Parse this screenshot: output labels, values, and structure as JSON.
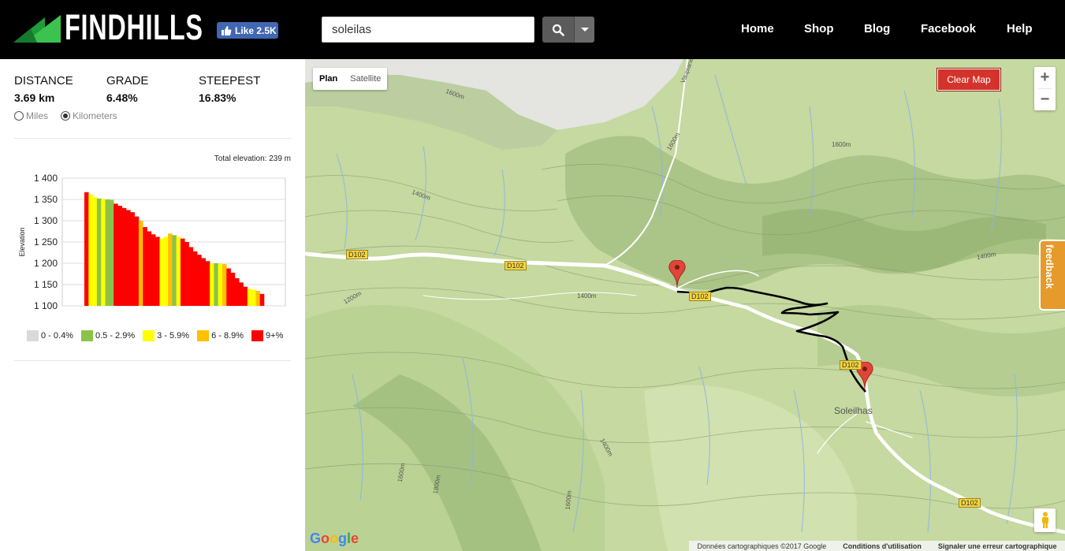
{
  "header": {
    "logo_text": "FINDHILLS",
    "like_label": "Like 2.5K",
    "search_value": "soleilas",
    "nav": [
      "Home",
      "Shop",
      "Blog",
      "Facebook",
      "Help"
    ]
  },
  "stats": {
    "distance_label": "DISTANCE",
    "distance_value": "3.69 km",
    "grade_label": "GRADE",
    "grade_value": "6.48%",
    "steepest_label": "STEEPEST",
    "steepest_value": "16.83%",
    "unit_miles": "Miles",
    "unit_km": "Kilometers",
    "selected_unit": "Kilometers"
  },
  "elevation": {
    "total_label": "Total elevation: 239 m"
  },
  "chart_data": {
    "type": "area",
    "title": "",
    "xlabel": "",
    "ylabel": "Elevation",
    "ylim": [
      1100,
      1400
    ],
    "yticks": [
      "1 400",
      "1 350",
      "1 300",
      "1 250",
      "1 200",
      "1 150",
      "1 100"
    ],
    "grid": true,
    "series": [
      {
        "values": [
          1367,
          1362,
          1355,
          1352,
          1351,
          1350,
          1349,
          1340,
          1335,
          1330,
          1325,
          1320,
          1310,
          1300,
          1285,
          1275,
          1268,
          1262,
          1258,
          1262,
          1270,
          1266,
          1262,
          1258,
          1250,
          1238,
          1228,
          1220,
          1212,
          1205,
          1200,
          1200,
          1199,
          1198,
          1188,
          1178,
          1165,
          1155,
          1145,
          1140,
          1138,
          1135,
          1128
        ],
        "grade_classes": [
          "9+",
          "3-5.9",
          "3-5.9",
          "0.5-2.9",
          "3-5.9",
          "0.5-2.9",
          "0.5-2.9",
          "9+",
          "9+",
          "9+",
          "9+",
          "9+",
          "9+",
          "6-8.9",
          "9+",
          "9+",
          "9+",
          "9+",
          "3-5.9",
          "3-5.9",
          "6-8.9",
          "0.5-2.9",
          "3-5.9",
          "9+",
          "9+",
          "9+",
          "9+",
          "9+",
          "9+",
          "9+",
          "3-5.9",
          "0.5-2.9",
          "3-5.9",
          "6-8.9",
          "9+",
          "9+",
          "9+",
          "9+",
          "9+",
          "3-5.9",
          "3-5.9",
          "6-8.9",
          "9+"
        ]
      }
    ],
    "legend": [
      {
        "label": "0 - 0.4%",
        "color": "#d9d9d9"
      },
      {
        "label": "0.5 - 2.9%",
        "color": "#8bc34a"
      },
      {
        "label": "3 - 5.9%",
        "color": "#ffff00"
      },
      {
        "label": "6 - 8.9%",
        "color": "#ffc000"
      },
      {
        "label": "9+%",
        "color": "#ff0000"
      }
    ]
  },
  "map": {
    "type_plan": "Plan",
    "type_satellite": "Satellite",
    "clear_label": "Clear Map",
    "zoom_in": "+",
    "zoom_out": "−",
    "feedback_label": "feedback",
    "town_label": "Soleilhas",
    "road_labels": [
      "D102",
      "D102",
      "D102",
      "D102",
      "D102"
    ],
    "contour_labels": [
      "1600m",
      "1600m",
      "1600m",
      "1400m",
      "1400m",
      "1400m",
      "1200m",
      "1400m",
      "1600m",
      "1800m",
      "1600m"
    ],
    "street_label": "Vaupiane",
    "google": "Google",
    "attribution_data": "Données cartographiques ©2017 Google",
    "attribution_terms": "Conditions d'utilisation",
    "attribution_report": "Signaler une erreur cartographique"
  },
  "colors": {
    "header_bg": "#000000",
    "clear_button": "#d3332a",
    "feedback_tab": "#e59a2b",
    "route": "#000000",
    "marker": "#e0453a"
  }
}
